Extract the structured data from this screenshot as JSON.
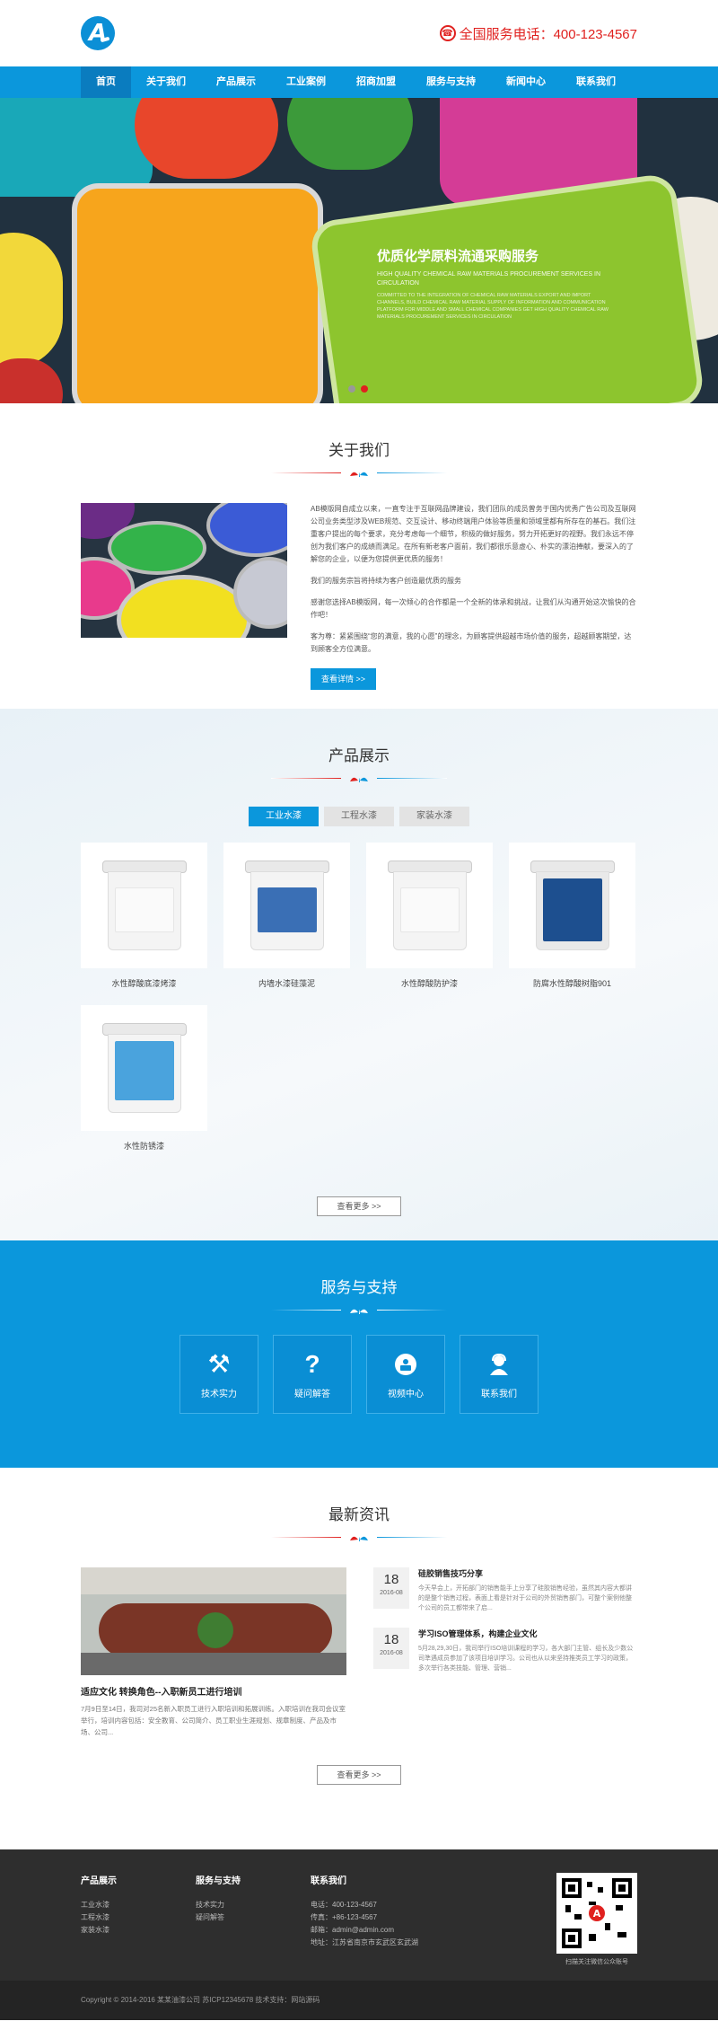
{
  "header": {
    "logo_letter": "A",
    "hotline": "全国服务电话：400-123-4567"
  },
  "nav": [
    "首页",
    "关于我们",
    "产品展示",
    "工业案例",
    "招商加盟",
    "服务与支持",
    "新闻中心",
    "联系我们"
  ],
  "banner": {
    "title": "优质化学原料流通采购服务",
    "subtitle": "HIGH QUALITY CHEMICAL RAW MATERIALS PROCUREMENT SERVICES IN CIRCULATION",
    "desc": "COMMITTED TO THE INTEGRATION OF CHEMICAL RAW MATERIALS EXPORT AND IMPORT CHANNELS, BUILD CHEMICAL RAW MATERIAL SUPPLY OF INFORMATION AND COMMUNICATION PLATFORM FOR MIDDLE AND SMALL CHEMICAL COMPANIES GET HIGH QUALITY CHEMICAL RAW MATERIALS PROCUREMENT SERVICES IN CIRCULATION"
  },
  "about": {
    "title": "关于我们",
    "p1": "AB模版网自成立以来，一直专注于互联网品牌建设，我们团队的成员曾务于国内优秀广告公司及互联网公司业务类型涉及WEB规范、交互设计、移动终端用户体验等质量和领域里都有所存在的基石。我们注重客户提出的每个要求，充分考虑每一个细节，积极的做好服务，努力开拓更好的视野。我们永远不停创为我们客户的成绩而满足。在所有新老客户面前，我们都很乐意虚心、朴实的漂泊捧献，要深入的了解您的企业，以便为您提供更优质的服务！",
    "p2": "我们的服务宗旨将持续为客户创造最优质的服务",
    "p3": "感谢您选择AB模版网，每一次倾心的合作都是一个全新的体承和挑战，让我们从沟通开始这次愉快的合作吧！",
    "p4": "客为尊：紧紧围绕“您的满意，我的心愿”的理念，为顾客提供超越市场价值的服务，超越顾客期望，达到顾客全方位满意。",
    "more": "查看详情 >>"
  },
  "products": {
    "title": "产品展示",
    "tabs": [
      "工业水漆",
      "工程水漆",
      "家装水漆"
    ],
    "items": [
      {
        "name": "水性醇酸底漆烤漆",
        "label_color": "#ffffff"
      },
      {
        "name": "内墙水漆硅藻泥",
        "label_color": "#3a6fb5"
      },
      {
        "name": "水性醇酸防护漆",
        "label_color": "#ffffff"
      },
      {
        "name": "防腐水性醇酸树脂901",
        "label_color": "#1d4f8f"
      },
      {
        "name": "水性防锈漆",
        "label_color": "#4aa3dd"
      }
    ],
    "more": "查看更多 >>"
  },
  "service": {
    "title": "服务与支持",
    "items": [
      {
        "label": "技术实力",
        "icon": "tools-icon"
      },
      {
        "label": "疑问解答",
        "icon": "question-icon"
      },
      {
        "label": "视频中心",
        "icon": "video-icon"
      },
      {
        "label": "联系我们",
        "icon": "support-icon"
      }
    ]
  },
  "news": {
    "title": "最新资讯",
    "main_title": "适应文化 转换角色--入职新员工进行培训",
    "main_desc": "7月9日至14日，我司对25名新入职员工进行入职培训和拓展训练。入职培训在我司会议室举行，培训内容包括：安全教育、公司简介、员工职业生涯规划、规章制度、产品及市场、公司...",
    "list": [
      {
        "day": "18",
        "ym": "2016-08",
        "title": "硅胶销售技巧分享",
        "desc": "今天早会上，开拓部门的销售能手上分享了硅胶销售经验，虽然其内容大都讲的是整个销售过程，表面上看是针对于公司的外贸销售部门，可整个案例他整个公司的员工都带来了启..."
      },
      {
        "day": "18",
        "ym": "2016-08",
        "title": "学习ISO管理体系，构建企业文化",
        "desc": "5月28,29,30日，我司举行ISO培训课程的学习，各大部门主管、组长及少数公司準遇成员参加了该项目培训学习。公司也从以来坚持推类员工学习的政策，多次举行各类技能、管理、营销..."
      }
    ],
    "more": "查看更多 >>"
  },
  "footer": {
    "col1_title": "产品展示",
    "col1": [
      "工业水漆",
      "工程水漆",
      "家装水漆"
    ],
    "col2_title": "服务与支持",
    "col2": [
      "技术实力",
      "疑问解答"
    ],
    "col3_title": "联系我们",
    "col3": [
      "电话：400-123-4567",
      "传真：+86-123-4567",
      "邮箱：admin@admin.com",
      "地址：江苏省南京市玄武区玄武湖"
    ],
    "qr_text": "扫描关注微信公众账号",
    "copyright": "Copyright © 2014-2016 某某油漆公司    苏ICP12345678    技术支持：网站源码"
  },
  "colors": {
    "primary": "#0b97dc",
    "accent": "#e0211f",
    "footer": "#2e2e2e"
  }
}
